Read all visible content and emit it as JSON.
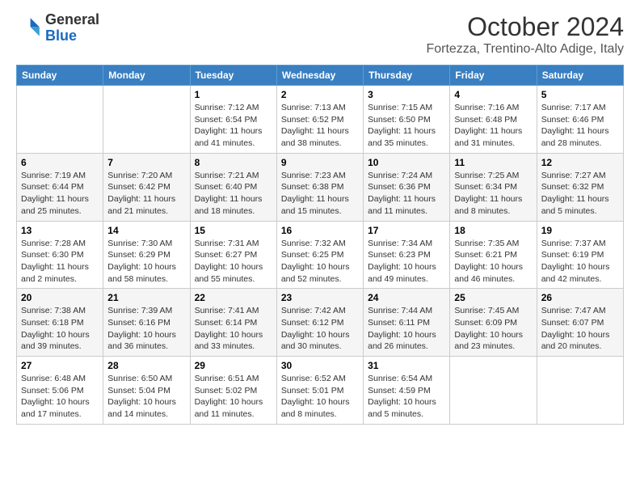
{
  "header": {
    "logo_general": "General",
    "logo_blue": "Blue",
    "month_title": "October 2024",
    "location": "Fortezza, Trentino-Alto Adige, Italy"
  },
  "days_of_week": [
    "Sunday",
    "Monday",
    "Tuesday",
    "Wednesday",
    "Thursday",
    "Friday",
    "Saturday"
  ],
  "weeks": [
    [
      {
        "day": "",
        "info": ""
      },
      {
        "day": "",
        "info": ""
      },
      {
        "day": "1",
        "info": "Sunrise: 7:12 AM\nSunset: 6:54 PM\nDaylight: 11 hours and 41 minutes."
      },
      {
        "day": "2",
        "info": "Sunrise: 7:13 AM\nSunset: 6:52 PM\nDaylight: 11 hours and 38 minutes."
      },
      {
        "day": "3",
        "info": "Sunrise: 7:15 AM\nSunset: 6:50 PM\nDaylight: 11 hours and 35 minutes."
      },
      {
        "day": "4",
        "info": "Sunrise: 7:16 AM\nSunset: 6:48 PM\nDaylight: 11 hours and 31 minutes."
      },
      {
        "day": "5",
        "info": "Sunrise: 7:17 AM\nSunset: 6:46 PM\nDaylight: 11 hours and 28 minutes."
      }
    ],
    [
      {
        "day": "6",
        "info": "Sunrise: 7:19 AM\nSunset: 6:44 PM\nDaylight: 11 hours and 25 minutes."
      },
      {
        "day": "7",
        "info": "Sunrise: 7:20 AM\nSunset: 6:42 PM\nDaylight: 11 hours and 21 minutes."
      },
      {
        "day": "8",
        "info": "Sunrise: 7:21 AM\nSunset: 6:40 PM\nDaylight: 11 hours and 18 minutes."
      },
      {
        "day": "9",
        "info": "Sunrise: 7:23 AM\nSunset: 6:38 PM\nDaylight: 11 hours and 15 minutes."
      },
      {
        "day": "10",
        "info": "Sunrise: 7:24 AM\nSunset: 6:36 PM\nDaylight: 11 hours and 11 minutes."
      },
      {
        "day": "11",
        "info": "Sunrise: 7:25 AM\nSunset: 6:34 PM\nDaylight: 11 hours and 8 minutes."
      },
      {
        "day": "12",
        "info": "Sunrise: 7:27 AM\nSunset: 6:32 PM\nDaylight: 11 hours and 5 minutes."
      }
    ],
    [
      {
        "day": "13",
        "info": "Sunrise: 7:28 AM\nSunset: 6:30 PM\nDaylight: 11 hours and 2 minutes."
      },
      {
        "day": "14",
        "info": "Sunrise: 7:30 AM\nSunset: 6:29 PM\nDaylight: 10 hours and 58 minutes."
      },
      {
        "day": "15",
        "info": "Sunrise: 7:31 AM\nSunset: 6:27 PM\nDaylight: 10 hours and 55 minutes."
      },
      {
        "day": "16",
        "info": "Sunrise: 7:32 AM\nSunset: 6:25 PM\nDaylight: 10 hours and 52 minutes."
      },
      {
        "day": "17",
        "info": "Sunrise: 7:34 AM\nSunset: 6:23 PM\nDaylight: 10 hours and 49 minutes."
      },
      {
        "day": "18",
        "info": "Sunrise: 7:35 AM\nSunset: 6:21 PM\nDaylight: 10 hours and 46 minutes."
      },
      {
        "day": "19",
        "info": "Sunrise: 7:37 AM\nSunset: 6:19 PM\nDaylight: 10 hours and 42 minutes."
      }
    ],
    [
      {
        "day": "20",
        "info": "Sunrise: 7:38 AM\nSunset: 6:18 PM\nDaylight: 10 hours and 39 minutes."
      },
      {
        "day": "21",
        "info": "Sunrise: 7:39 AM\nSunset: 6:16 PM\nDaylight: 10 hours and 36 minutes."
      },
      {
        "day": "22",
        "info": "Sunrise: 7:41 AM\nSunset: 6:14 PM\nDaylight: 10 hours and 33 minutes."
      },
      {
        "day": "23",
        "info": "Sunrise: 7:42 AM\nSunset: 6:12 PM\nDaylight: 10 hours and 30 minutes."
      },
      {
        "day": "24",
        "info": "Sunrise: 7:44 AM\nSunset: 6:11 PM\nDaylight: 10 hours and 26 minutes."
      },
      {
        "day": "25",
        "info": "Sunrise: 7:45 AM\nSunset: 6:09 PM\nDaylight: 10 hours and 23 minutes."
      },
      {
        "day": "26",
        "info": "Sunrise: 7:47 AM\nSunset: 6:07 PM\nDaylight: 10 hours and 20 minutes."
      }
    ],
    [
      {
        "day": "27",
        "info": "Sunrise: 6:48 AM\nSunset: 5:06 PM\nDaylight: 10 hours and 17 minutes."
      },
      {
        "day": "28",
        "info": "Sunrise: 6:50 AM\nSunset: 5:04 PM\nDaylight: 10 hours and 14 minutes."
      },
      {
        "day": "29",
        "info": "Sunrise: 6:51 AM\nSunset: 5:02 PM\nDaylight: 10 hours and 11 minutes."
      },
      {
        "day": "30",
        "info": "Sunrise: 6:52 AM\nSunset: 5:01 PM\nDaylight: 10 hours and 8 minutes."
      },
      {
        "day": "31",
        "info": "Sunrise: 6:54 AM\nSunset: 4:59 PM\nDaylight: 10 hours and 5 minutes."
      },
      {
        "day": "",
        "info": ""
      },
      {
        "day": "",
        "info": ""
      }
    ]
  ]
}
